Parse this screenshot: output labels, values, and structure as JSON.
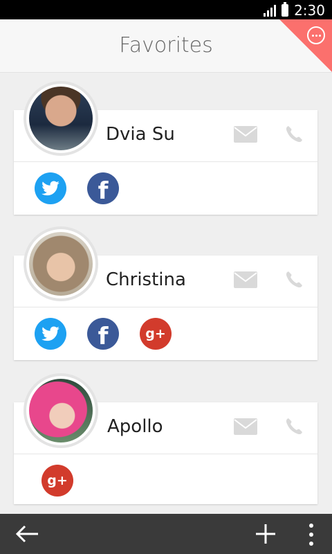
{
  "status_bar": {
    "time": "2:30"
  },
  "header": {
    "title": "Favorites"
  },
  "contacts": [
    {
      "name": "Dvia Su",
      "socials": [
        "twitter",
        "facebook"
      ]
    },
    {
      "name": "Christina",
      "socials": [
        "twitter",
        "facebook",
        "google-plus"
      ]
    },
    {
      "name": "Apollo",
      "socials": [
        "google-plus"
      ]
    }
  ],
  "icons": {
    "twitter": "twitter-icon",
    "facebook": "facebook-icon",
    "google_plus": "google-plus-icon",
    "mail": "mail-icon",
    "phone": "phone-icon",
    "back": "back-arrow-icon",
    "add": "add-icon",
    "more": "more-icon"
  },
  "glyphs": {
    "facebook": "f",
    "google_plus": "g+"
  },
  "colors": {
    "accent": "#fb706d",
    "twitter": "#1da1f2",
    "facebook": "#3b5998",
    "google_plus": "#d23b2c",
    "bottom_bar": "#3a3a3a"
  }
}
